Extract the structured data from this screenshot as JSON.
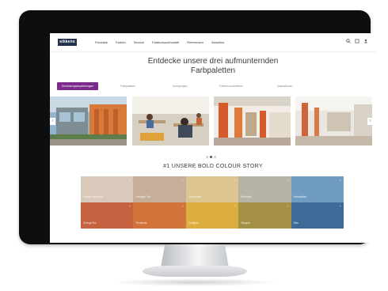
{
  "header": {
    "logo": "sikkens",
    "nav": [
      "Produkte",
      "Farben",
      "Service",
      "Farbtonsuchhandel",
      "Referenzen",
      "Aktuelles"
    ],
    "icons": [
      "search-icon",
      "cart-icon",
      "user-icon"
    ]
  },
  "headline": {
    "line1": "Entdecke unsere drei aufmunternden",
    "line2": "Farbpaletten"
  },
  "tabs": [
    "Einrichtungsempfehlungen",
    "Farbpaletten",
    "Anregungen",
    "Farben kombinieren",
    "Inspirationen"
  ],
  "carousel": {
    "prev_icon": "chevron-left-icon",
    "next_icon": "chevron-right-icon",
    "dots": 3,
    "active_dot": 1
  },
  "section_title": "#1 UNSERE BOLD COLOUR STORY",
  "swatches": [
    {
      "name": "Grüner Schimmer",
      "color": "#d9c9bb"
    },
    {
      "name": "Sandiger Ton",
      "color": "#c6ae99"
    },
    {
      "name": "Sonnenhell",
      "color": "#ddc592"
    },
    {
      "name": "Steinweiß",
      "color": "#b7b3a4"
    },
    {
      "name": "Himmelblau",
      "color": "#6f9cc0"
    },
    {
      "name": "Orange Rot",
      "color": "#c76241"
    },
    {
      "name": "Terrakotta",
      "color": "#d2733a"
    },
    {
      "name": "Goldgelb",
      "color": "#dcae3e"
    },
    {
      "name": "Olivgrün",
      "color": "#a49146"
    },
    {
      "name": "Blau",
      "color": "#3d6a96"
    }
  ]
}
